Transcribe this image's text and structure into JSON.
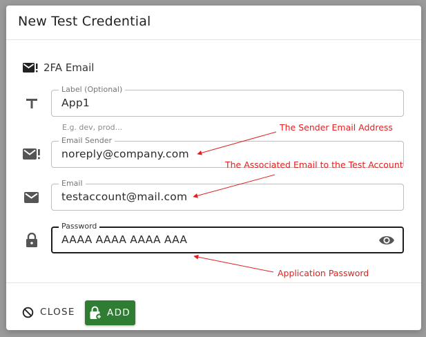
{
  "dialog": {
    "title": "New Test Credential",
    "type_label": "2FA Email"
  },
  "fields": {
    "label": {
      "label": "Label (Optional)",
      "value": "App1",
      "helper": "E.g. dev, prod..."
    },
    "email_sender": {
      "label": "Email Sender",
      "value": "noreply@company.com"
    },
    "email": {
      "label": "Email",
      "value": "testaccount@mail.com"
    },
    "password": {
      "label": "Password",
      "value": "AAAA AAAA AAAA AAA"
    }
  },
  "annotations": {
    "sender": "The Sender Email Address",
    "associated": "The Associated Email to the Test Account",
    "app_password": "Application Password"
  },
  "buttons": {
    "close": "CLOSE",
    "add": "ADD"
  },
  "colors": {
    "primary": "#2e7d32",
    "annotation": "#e32020",
    "focused_border": "#1c1c1c"
  },
  "icons": [
    "email-alert-icon",
    "text-format-icon",
    "email-icon",
    "lock-icon",
    "eye-icon",
    "cancel-icon",
    "lock-plus-icon"
  ]
}
